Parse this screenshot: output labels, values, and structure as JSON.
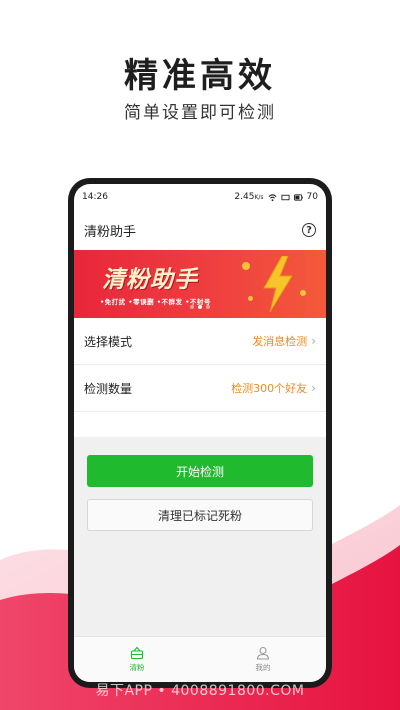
{
  "promo": {
    "headline": "精准高效",
    "subheadline": "简单设置即可检测"
  },
  "status_bar": {
    "time": "14:26",
    "speed": "2.45",
    "speed_unit": "K/s",
    "battery": "70"
  },
  "app": {
    "title": "清粉助手",
    "help_icon": "question-circle-icon"
  },
  "banner": {
    "title": "清粉助手",
    "tags": "•免打扰 •零误删 •不群发 •不封号",
    "icon": "lightning-bolt-icon"
  },
  "settings": {
    "mode": {
      "label": "选择模式",
      "value": "发消息检测"
    },
    "count": {
      "label": "检测数量",
      "value": "检测300个好友"
    }
  },
  "actions": {
    "start_label": "开始检测",
    "clean_label": "清理已标记死粉"
  },
  "tabs": [
    {
      "label": "清粉",
      "icon": "basket-icon",
      "active": true
    },
    {
      "label": "我的",
      "icon": "user-icon",
      "active": false
    }
  ],
  "watermark": "易下APP • 4008891800.COM",
  "colors": {
    "accent_green": "#1fba2d",
    "value_orange": "#f08a1c",
    "banner_red": "#e8263c",
    "wave_red": "#ea1d4b"
  }
}
